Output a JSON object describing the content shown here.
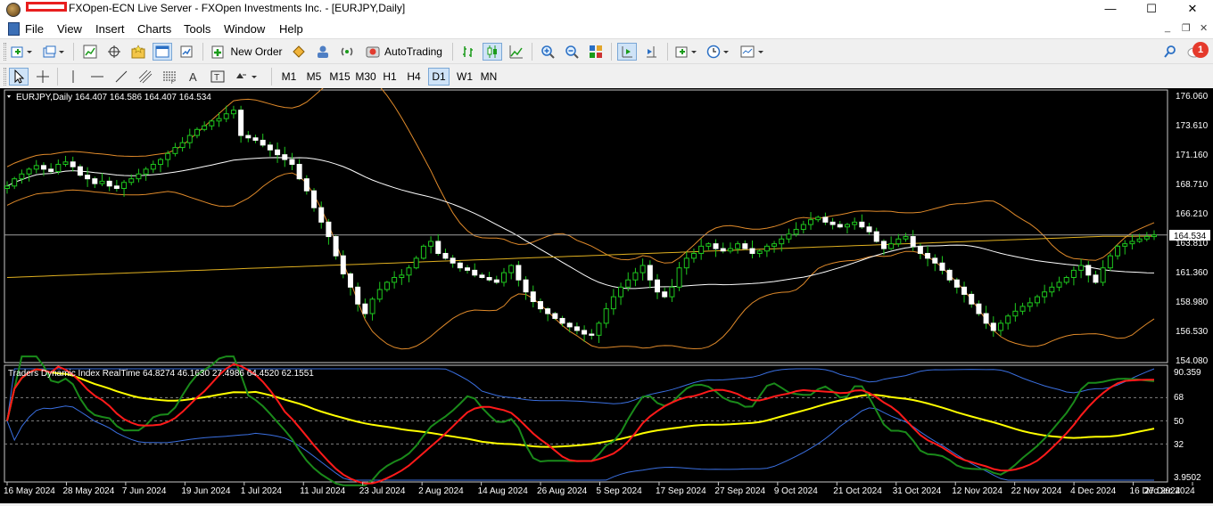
{
  "window": {
    "title": "FXOpen-ECN Live Server - FXOpen Investments Inc. - [EURJPY,Daily]",
    "minimize": "—",
    "maximize": "☐",
    "close": "✕"
  },
  "menu": {
    "items": [
      "File",
      "View",
      "Insert",
      "Charts",
      "Tools",
      "Window",
      "Help"
    ],
    "mdi_minimize": "_",
    "mdi_restore": "❐",
    "mdi_close": "✕"
  },
  "toolbar": {
    "new_order_label": "New Order",
    "autotrading_label": "AutoTrading",
    "notification_count": "1",
    "timeframes": [
      "M1",
      "M5",
      "M15",
      "M30",
      "H1",
      "H4",
      "D1",
      "W1",
      "MN"
    ],
    "active_timeframe": "D1"
  },
  "chart_data": {
    "type": "candlestick",
    "symbol_header": "EURJPY,Daily  164.407 164.586 164.407 164.534",
    "price_axis_ticks": [
      "176.060",
      "173.610",
      "171.160",
      "168.710",
      "166.210",
      "163.810",
      "161.360",
      "158.980",
      "156.530",
      "154.080"
    ],
    "current_price_label": "164.534",
    "current_price": 164.534,
    "price_range": [
      154.08,
      176.06
    ],
    "indicator": {
      "header": "Traders Dynamic Index RealTime 64.8274 46.1630 27.4986 64.4520 62.1551",
      "axis_ticks": [
        "90.359",
        "68",
        "50",
        "32",
        "3.9502"
      ],
      "levels": [
        68,
        50,
        32
      ],
      "range": [
        3.9502,
        90.359
      ],
      "series_colors": {
        "rsi_price_line": "#1a8a1a",
        "trade_signal_line": "#ff1a1a",
        "market_base_line": "#ffff00",
        "volatility_band": "#3a6fe0"
      }
    },
    "date_labels": [
      "16 May 2024",
      "28 May 2024",
      "7 Jun 2024",
      "19 Jun 2024",
      "1 Jul 2024",
      "11 Jul 2024",
      "23 Jul 2024",
      "2 Aug 2024",
      "14 Aug 2024",
      "26 Aug 2024",
      "5 Sep 2024",
      "17 Sep 2024",
      "27 Sep 2024",
      "9 Oct 2024",
      "21 Oct 2024",
      "31 Oct 2024",
      "12 Nov 2024",
      "22 Nov 2024",
      "4 Dec 2024",
      "16 Dec 2024",
      "27 Dec 2024"
    ],
    "close_path": [
      168.6,
      169.2,
      169.6,
      170.0,
      170.3,
      170.0,
      169.8,
      170.4,
      170.6,
      170.2,
      169.5,
      169.2,
      168.8,
      169.0,
      168.6,
      168.4,
      168.9,
      169.2,
      169.6,
      170.0,
      170.4,
      170.8,
      171.3,
      171.8,
      172.2,
      172.8,
      173.3,
      173.6,
      174.0,
      174.2,
      174.6,
      174.9,
      172.8,
      172.6,
      172.4,
      172.0,
      171.6,
      171.2,
      170.8,
      170.4,
      169.2,
      168.2,
      166.8,
      165.6,
      164.4,
      162.8,
      161.3,
      160.2,
      158.8,
      158.0,
      159.2,
      160.0,
      160.6,
      161.0,
      161.2,
      161.8,
      162.6,
      163.6,
      164.0,
      163.0,
      162.6,
      162.2,
      161.8,
      161.6,
      161.2,
      161.0,
      160.8,
      160.6,
      161.4,
      162.0,
      160.8,
      159.8,
      159.0,
      158.4,
      158.0,
      157.6,
      157.2,
      156.9,
      156.6,
      156.3,
      156.2,
      157.2,
      158.4,
      159.4,
      160.2,
      160.8,
      161.4,
      162.0,
      160.8,
      159.8,
      159.4,
      160.2,
      161.8,
      162.6,
      163.0,
      163.6,
      163.8,
      163.4,
      163.2,
      163.4,
      163.8,
      163.4,
      163.0,
      163.2,
      163.6,
      163.8,
      164.2,
      164.6,
      165.0,
      165.4,
      165.8,
      166.0,
      165.6,
      165.4,
      165.2,
      165.4,
      165.6,
      165.2,
      164.8,
      164.0,
      163.4,
      163.8,
      164.2,
      164.4,
      163.6,
      163.0,
      162.6,
      162.2,
      161.6,
      160.8,
      160.2,
      159.6,
      158.8,
      158.0,
      157.2,
      156.6,
      157.2,
      157.8,
      158.2,
      158.6,
      158.9,
      159.4,
      159.8,
      160.2,
      160.6,
      161.0,
      161.6,
      162.0,
      161.2,
      160.6,
      161.8,
      162.8,
      163.6,
      163.8,
      164.0,
      164.2,
      164.4,
      164.534
    ]
  }
}
